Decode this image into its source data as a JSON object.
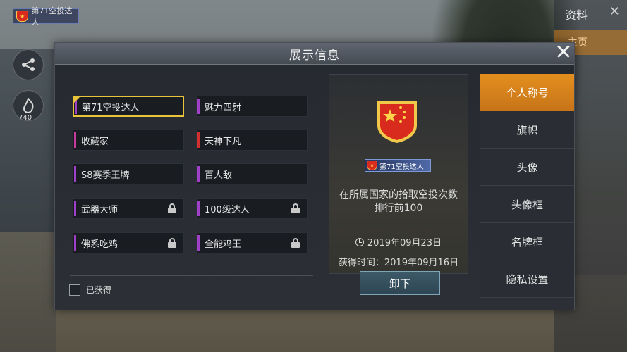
{
  "dialog": {
    "title": "展示信息",
    "close_label": "✕"
  },
  "background": {
    "top_badge_text": "第71空投达人",
    "level_label": "740",
    "panel_title": "资料",
    "panel_close": "✕",
    "panel_home": "主页"
  },
  "titles": [
    {
      "label": "第71空投达人",
      "accent": "#a040c8",
      "selected": true,
      "locked": false
    },
    {
      "label": "魅力四射",
      "accent": "#a040c8",
      "selected": false,
      "locked": false
    },
    {
      "label": "收藏家",
      "accent": "#c83a9e",
      "selected": false,
      "locked": false
    },
    {
      "label": "天神下凡",
      "accent": "#d23030",
      "selected": false,
      "locked": false
    },
    {
      "label": "S8赛季王牌",
      "accent": "#a040c8",
      "selected": false,
      "locked": false
    },
    {
      "label": "百人敌",
      "accent": "#a040c8",
      "selected": false,
      "locked": false
    },
    {
      "label": "武器大师",
      "accent": "#a040c8",
      "selected": false,
      "locked": true
    },
    {
      "label": "100级达人",
      "accent": "#a040c8",
      "selected": false,
      "locked": true
    },
    {
      "label": "佛系吃鸡",
      "accent": "#a040c8",
      "selected": false,
      "locked": true
    },
    {
      "label": "全能鸡王",
      "accent": "#a040c8",
      "selected": false,
      "locked": true
    }
  ],
  "filter": {
    "obtained_label": "已获得",
    "checked": false
  },
  "preview": {
    "badge_text": "第71空投达人",
    "description": "在所属国家的拾取空投次数排行前100",
    "expiry": "2019年09月23日",
    "obtained_time": "获得时间：2019年09月16日",
    "unequip_label": "卸下"
  },
  "tabs": [
    {
      "label": "个人称号",
      "active": true
    },
    {
      "label": "旗帜",
      "active": false
    },
    {
      "label": "头像",
      "active": false
    },
    {
      "label": "头像框",
      "active": false
    },
    {
      "label": "名牌框",
      "active": false
    },
    {
      "label": "隐私设置",
      "active": false
    }
  ],
  "colors": {
    "accent_orange": "#d7821c",
    "selected_border": "#e9c43a",
    "flag_red": "#d82b1e",
    "flag_star": "#ffd54a"
  }
}
